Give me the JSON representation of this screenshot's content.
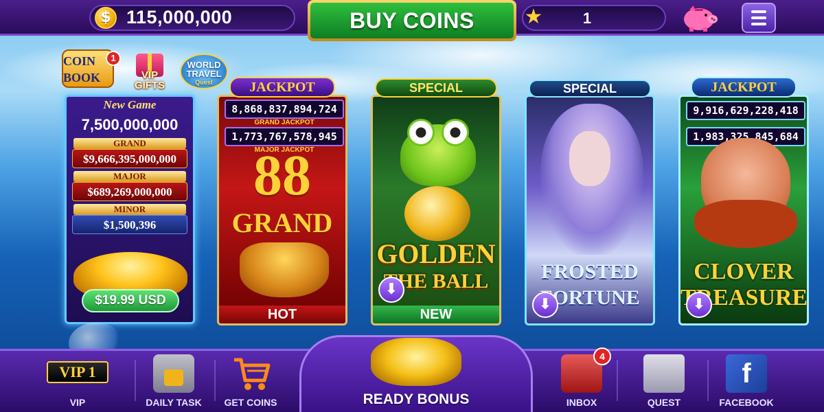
{
  "topbar": {
    "coins": "115,000,000",
    "buy_coins_label": "BUY COINS",
    "level": "1",
    "icons": {
      "coin": "coin-icon",
      "star": "star-icon",
      "piggy": "piggy-bank-icon",
      "menu": "menu-icon"
    }
  },
  "badges": {
    "coin_book": "COIN BOOK",
    "coin_book_count": "1",
    "vip_gifts": "VIP GIFTS",
    "world_travel": "WORLD TRAVEL",
    "world_travel_sub": "Quest"
  },
  "vip_card": {
    "header": "New Game",
    "amount": "7,500,000,000",
    "tiers": [
      {
        "label": "GRAND",
        "value": "$9,666,395,000,000"
      },
      {
        "label": "MAJOR",
        "value": "$689,269,000,000"
      },
      {
        "label": "MINOR",
        "value": "$1,500,396"
      }
    ],
    "price": "$19.99 USD"
  },
  "games": [
    {
      "banner": "JACKPOT",
      "grand_jackpot": "8,868,837,894,724",
      "grand_tag": "GRAND JACKPOT",
      "major_jackpot": "1,773,767,578,945",
      "major_tag": "MAJOR JACKPOT",
      "art_big": "88",
      "art_sub": "GRAND",
      "tag": "HOT"
    },
    {
      "banner": "SPECIAL",
      "title_line1": "GOLDEN",
      "title_line2": "THE BALL",
      "tag": "NEW",
      "download_icon": "download-icon"
    },
    {
      "banner": "SPECIAL",
      "title_line1": "FROSTED",
      "title_line2": "FORTUNE",
      "download_icon": "download-icon"
    },
    {
      "banner": "JACKPOT",
      "grand_jackpot": "9,916,629,228,418",
      "major_jackpot": "1,983,325,845,684",
      "title_line1": "CLOVER",
      "title_line2": "TREASURE",
      "download_icon": "download-icon"
    }
  ],
  "bottom_nav": {
    "vip_badge": "VIP 1",
    "vip": "VIP",
    "daily_task": "DAILY TASK",
    "get_coins": "GET COINS",
    "ready_bonus": "READY BONUS",
    "inbox": "INBOX",
    "inbox_count": "4",
    "quest": "QUEST",
    "facebook": "FACEBOOK",
    "facebook_glyph": "f"
  }
}
